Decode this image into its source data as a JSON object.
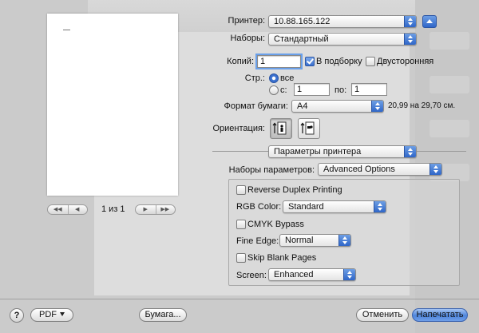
{
  "printer": {
    "label": "Принтер:",
    "value": "10.88.165.122"
  },
  "presets": {
    "label": "Наборы:",
    "value": "Стандартный"
  },
  "copies": {
    "label": "Копий:",
    "value": "1",
    "collate_label": "В подборку",
    "collate_checked": true,
    "duplex_label": "Двусторонняя",
    "duplex_checked": false
  },
  "pages": {
    "label": "Стр.:",
    "all_label": "все",
    "from_label": "с:",
    "from_value": "1",
    "to_label": "по:",
    "to_value": "1",
    "selected": "all"
  },
  "paper_size": {
    "label": "Формат бумаги:",
    "value": "A4",
    "dimensions": "20,99 на 29,70 см."
  },
  "orientation": {
    "label": "Ориентация:",
    "selected": "portrait"
  },
  "pane_selector": {
    "value": "Параметры принтера"
  },
  "feature_sets": {
    "label": "Наборы параметров:",
    "value": "Advanced Options"
  },
  "advanced": {
    "reverse_duplex_label": "Reverse Duplex Printing",
    "rgb_color_label": "RGB Color:",
    "rgb_color_value": "Standard",
    "cmyk_bypass_label": "CMYK Bypass",
    "fine_edge_label": "Fine Edge:",
    "fine_edge_value": "Normal",
    "skip_blank_label": "Skip Blank Pages",
    "screen_label": "Screen:",
    "screen_value": "Enhanced"
  },
  "preview": {
    "page_indicator": "1 из 1",
    "nav_first": "◀◀",
    "nav_prev": "◀",
    "nav_next": "▶",
    "nav_last": "▶▶"
  },
  "footer": {
    "help": "?",
    "pdf_label": "PDF",
    "paper_button": "Бумага...",
    "cancel_button": "Отменить",
    "print_button": "Напечатать"
  }
}
